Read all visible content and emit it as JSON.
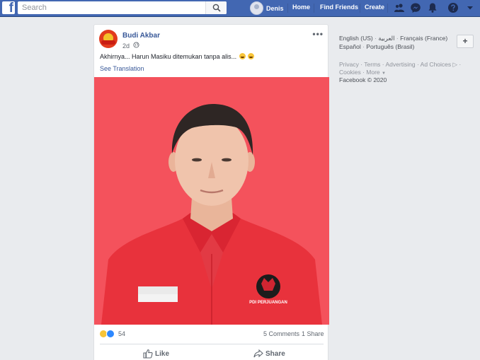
{
  "colors": {
    "brand": "#4267b2",
    "link": "#385898",
    "photo_bg": "#f3505a",
    "shirt": "#e8323c"
  },
  "topbar": {
    "logo_letter": "f",
    "search_placeholder": "Search",
    "user_name": "Denis",
    "nav": [
      "Home",
      "Find Friends",
      "Create"
    ],
    "icons": [
      "friends-icon",
      "messenger-icon",
      "notifications-icon",
      "help-icon",
      "account-menu-icon"
    ]
  },
  "post": {
    "author": "Budi Akbar",
    "time": "2d",
    "text": "Akhirnya... Harun Masiku ditemukan tanpa alis...",
    "see_translation": "See Translation",
    "photo_description_alt": "",
    "reactions_count": "54",
    "comments": "5 Comments",
    "shares": "1 Share",
    "actions": {
      "like": "Like",
      "share": "Share"
    },
    "badge_text": "PDI PERJUANGAN"
  },
  "sidebar": {
    "languages_line1": [
      "English (US)",
      "العربية",
      "Français (France)"
    ],
    "languages_line2": [
      "Español",
      "Português (Brasil)"
    ],
    "add_language": "+",
    "footer_line1": [
      "Privacy",
      "Terms",
      "Advertising",
      "Ad Choices"
    ],
    "footer_line2": [
      "Cookies",
      "More"
    ],
    "copyright": "Facebook © 2020"
  }
}
